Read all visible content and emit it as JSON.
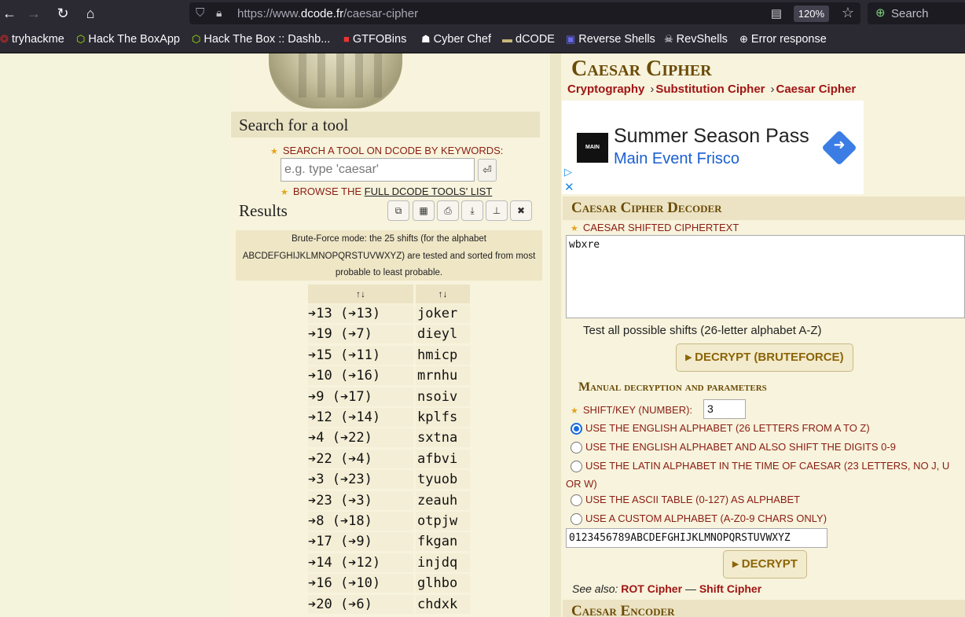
{
  "browser": {
    "url_prefix": "https://www.",
    "url_host": "dcode.fr",
    "url_path": "/caesar-cipher",
    "zoom": "120%",
    "search_label": "Search",
    "bookmarks": [
      "tryhackme",
      "Hack The BoxApp",
      "Hack The Box :: Dashb...",
      "GTFOBins",
      "Cyber Chef",
      "dCODE",
      "Reverse Shells",
      "RevShells",
      "Error response"
    ]
  },
  "left": {
    "search_heading": "Search for a tool",
    "search_label": "SEARCH A TOOL ON DCODE BY KEYWORDS:",
    "search_placeholder": "e.g. type 'caesar'",
    "browse_prefix": "BROWSE THE ",
    "browse_link": "FULL DCODE TOOLS' LIST",
    "results_heading": "Results",
    "bruteforce_note": "Brute-Force mode: the 25 shifts (for the alphabet ABCDEFGHIJKLMNOPQRSTUVWXYZ) are tested and sorted from most probable to least probable.",
    "table_headers": [
      "↑↓",
      "↑↓"
    ],
    "rows": [
      {
        "shift": "➔13 (➔13)",
        "text": "joker"
      },
      {
        "shift": "➔19 (➔7)",
        "text": "dieyl"
      },
      {
        "shift": "➔15 (➔11)",
        "text": "hmicp"
      },
      {
        "shift": "➔10 (➔16)",
        "text": "mrnhu"
      },
      {
        "shift": "➔9 (➔17)",
        "text": "nsoiv"
      },
      {
        "shift": "➔12 (➔14)",
        "text": "kplfs"
      },
      {
        "shift": "➔4 (➔22)",
        "text": "sxtna"
      },
      {
        "shift": "➔22 (➔4)",
        "text": "afbvi"
      },
      {
        "shift": "➔3 (➔23)",
        "text": "tyuob"
      },
      {
        "shift": "➔23 (➔3)",
        "text": "zeauh"
      },
      {
        "shift": "➔8 (➔18)",
        "text": "otpjw"
      },
      {
        "shift": "➔17 (➔9)",
        "text": "fkgan"
      },
      {
        "shift": "➔14 (➔12)",
        "text": "injdq"
      },
      {
        "shift": "➔16 (➔10)",
        "text": "glhbo"
      },
      {
        "shift": "➔20 (➔6)",
        "text": "chdxk"
      }
    ]
  },
  "right": {
    "title": "Caesar Cipher",
    "breadcrumbs": [
      "Cryptography",
      "Substitution Cipher",
      "Caesar Cipher"
    ],
    "ad": {
      "logo": "MAIN EVENT",
      "line1": "Summer Season Pass",
      "line2": "Main Event Frisco"
    },
    "decoder_heading": "Caesar Cipher Decoder",
    "ciphertext_label": "CAESAR SHIFTED CIPHERTEXT",
    "ciphertext_value": "wbxre",
    "test_all_label": "Test all possible shifts (26-letter alphabet A-Z)",
    "bruteforce_button": "▸ DECRYPT (BRUTEFORCE)",
    "manual_heading": "Manual decryption and parameters",
    "shift_label": "SHIFT/KEY (NUMBER):",
    "shift_value": "3",
    "options": [
      "USE THE ENGLISH ALPHABET (26 LETTERS FROM A TO Z)",
      "USE THE ENGLISH ALPHABET AND ALSO SHIFT THE DIGITS 0-9",
      "USE THE LATIN ALPHABET IN THE TIME OF CAESAR (23 LETTERS, NO J, U",
      "OR W)",
      "USE THE ASCII TABLE (0-127) AS ALPHABET",
      "USE A CUSTOM ALPHABET (A-Z0-9 CHARS ONLY)"
    ],
    "custom_alphabet": "0123456789ABCDEFGHIJKLMNOPQRSTUVWXYZ",
    "decrypt_button": "▸ DECRYPT",
    "see_also_label": "See also:",
    "see_also_links": [
      "ROT Cipher",
      "Shift Cipher"
    ],
    "see_also_sep": "—",
    "encoder_heading": "Caesar Encoder"
  }
}
